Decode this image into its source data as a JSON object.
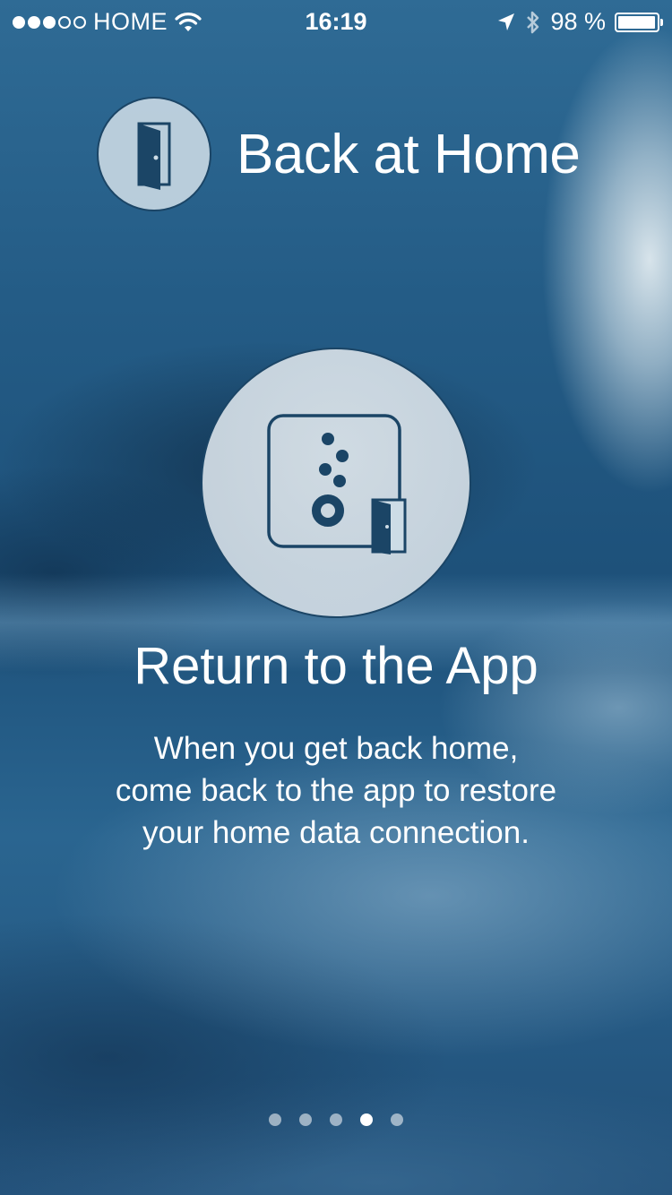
{
  "status_bar": {
    "carrier": "HOME",
    "signal_full": 3,
    "signal_empty": 2,
    "time": "16:19",
    "battery": "98 %",
    "battery_level_percent": 98,
    "icons": [
      "wifi-icon",
      "location-arrow-icon",
      "bluetooth-icon",
      "battery-icon"
    ]
  },
  "header": {
    "title": "Back at Home",
    "logo_icon": "door-icon"
  },
  "main": {
    "icon": "hub-door-icon",
    "headline": "Return to the App",
    "body_line_1": "When you get back home,",
    "body_line_2": "come back to the app to restore",
    "body_line_3": "your home data connection."
  },
  "pager": {
    "count": 5,
    "active_index": 3
  },
  "colors": {
    "icon_dark": "#1b4566",
    "circle_fill": "#cddce6",
    "background": "#1c4d73",
    "text": "#ffffff"
  }
}
